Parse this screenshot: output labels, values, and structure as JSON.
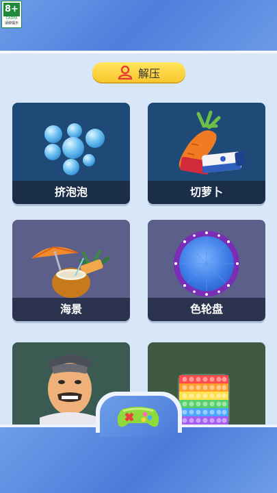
{
  "age_rating": {
    "label": "8+",
    "org": "CADPA",
    "note": "适龄提示"
  },
  "section": {
    "title": "解压",
    "icon": "user-icon"
  },
  "cards": [
    {
      "label": "挤泡泡",
      "icon": "bubbles-icon",
      "bg": "#1f4a78"
    },
    {
      "label": "切萝卜",
      "icon": "carrot-knife-icon",
      "bg": "#1f4a78"
    },
    {
      "label": "海景",
      "icon": "coconut-umbrella-icon",
      "bg": "#5c5f8a"
    },
    {
      "label": "色轮盘",
      "icon": "color-wheel-icon",
      "bg": "#5c5f8a"
    },
    {
      "label": "",
      "icon": "cartoon-face-icon",
      "bg": "#3a5a52"
    },
    {
      "label": "",
      "icon": "pop-it-icon",
      "bg": "#3f5a40"
    }
  ],
  "tab_bar": {
    "center_icon": "gamepad-icon"
  }
}
